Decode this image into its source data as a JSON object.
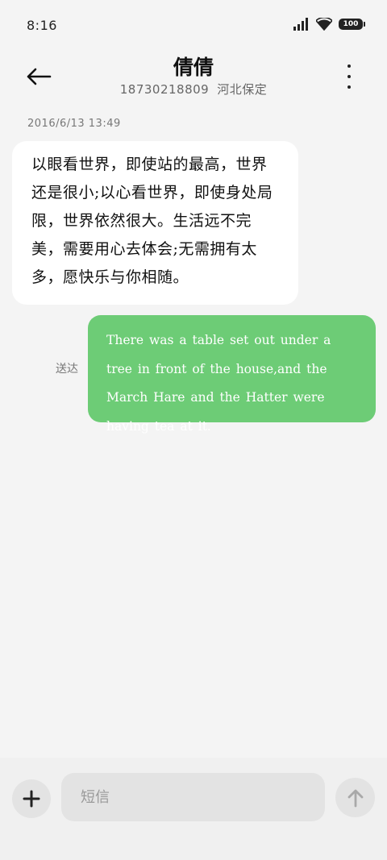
{
  "status_bar": {
    "time": "8:16",
    "battery": "100",
    "icons": [
      "signal-icon",
      "wifi-icon",
      "battery-icon"
    ]
  },
  "header": {
    "contact_name": "倩倩",
    "phone_number": "18730218809",
    "location": "河北保定",
    "back_icon": "back-arrow-icon",
    "more_icon": "more-vertical-icon"
  },
  "conversation": {
    "timestamp": "2016/6/13  13:49",
    "received_message": "以眼看世界，即使站的最高，世界还是很小;以心看世界，即使身处局限，世界依然很大。生活远不完美，需要用心去体会;无需拥有太多，愿快乐与你相随。",
    "sent_status": "送达",
    "sent_message": "There was a table set out under a tree in front of the house,and the March Hare and the Hatter were having tea at it."
  },
  "input_bar": {
    "placeholder": "短信",
    "add_icon": "plus-icon",
    "send_icon": "send-arrow-icon"
  },
  "colors": {
    "background": "#f4f4f4",
    "sent_bubble": "#6dcc76",
    "received_bubble": "#ffffff"
  }
}
